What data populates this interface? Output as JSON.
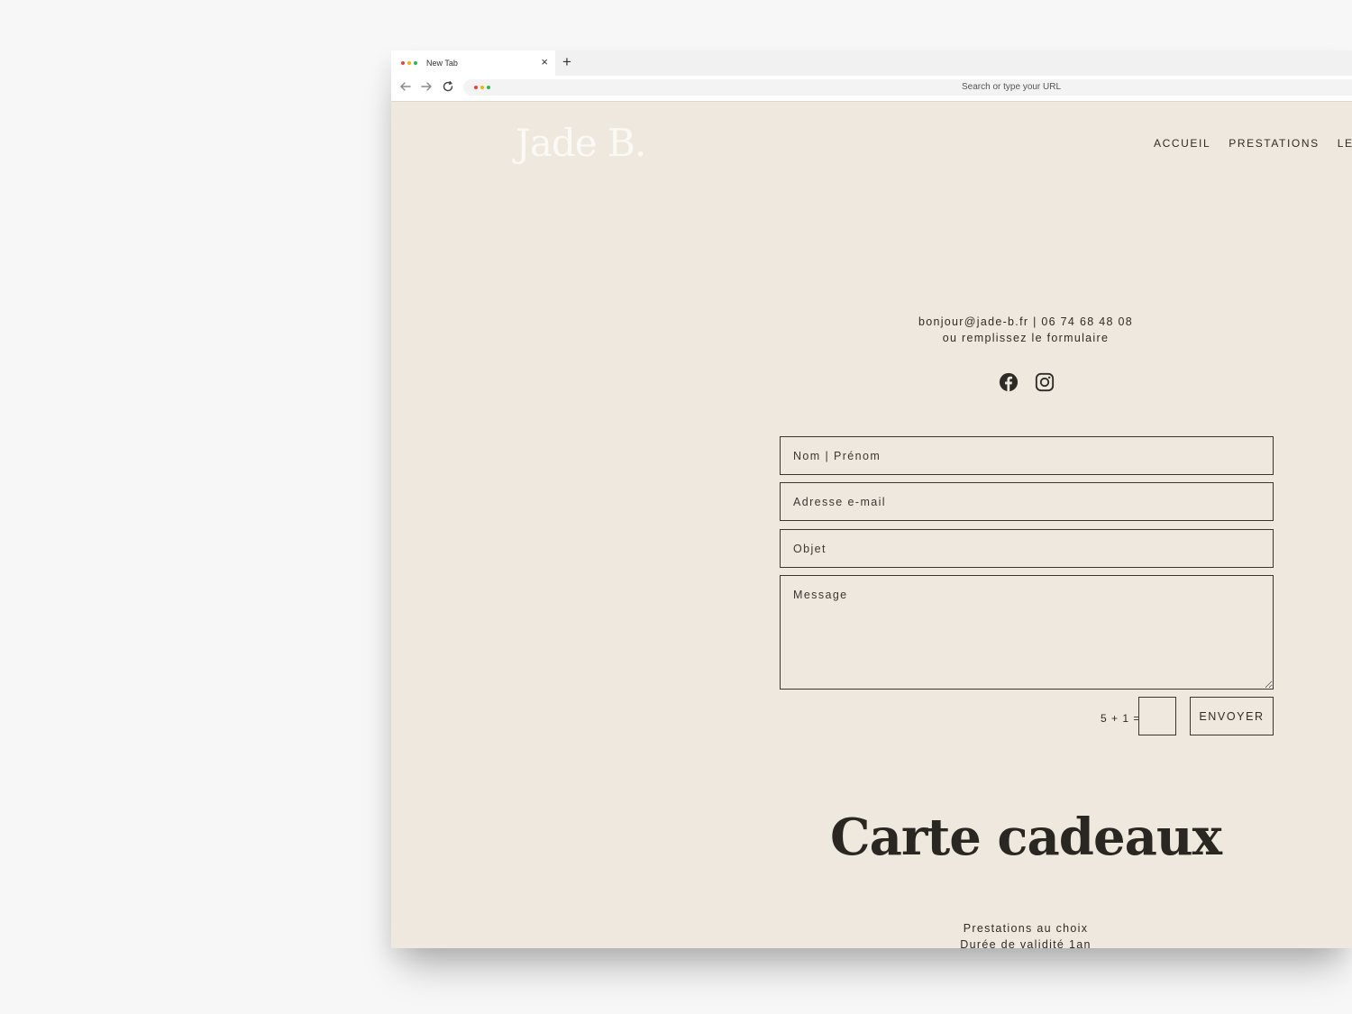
{
  "browser": {
    "tab_title": "New Tab",
    "tab_close": "×",
    "new_tab": "+",
    "url_placeholder": "Search or type your URL",
    "dot_colors": [
      "#e8453c",
      "#f5b400",
      "#2db84d"
    ]
  },
  "site": {
    "logo": "Jade B.",
    "nav": [
      "ACCUEIL",
      "PRESTATIONS",
      "LE"
    ],
    "contact": {
      "line1": "bonjour@jade-b.fr | 06 74 68 48 08",
      "line2": "ou remplissez le formulaire"
    },
    "social": [
      "facebook-icon",
      "instagram-icon"
    ],
    "form": {
      "name_placeholder": "Nom | Prénom",
      "email_placeholder": "Adresse e-mail",
      "subject_placeholder": "Objet",
      "message_placeholder": "Message",
      "captcha_label": "5 + 1 =",
      "captcha_value": "",
      "submit_label": "ENVOYER"
    },
    "gift": {
      "title": "Carte cadeaux",
      "line1": "Prestations au choix",
      "line2": "Durée de validité 1an"
    }
  },
  "colors": {
    "page_bg": "#efe8de",
    "text": "#2e2b27",
    "logo": "#fbf9f5"
  }
}
